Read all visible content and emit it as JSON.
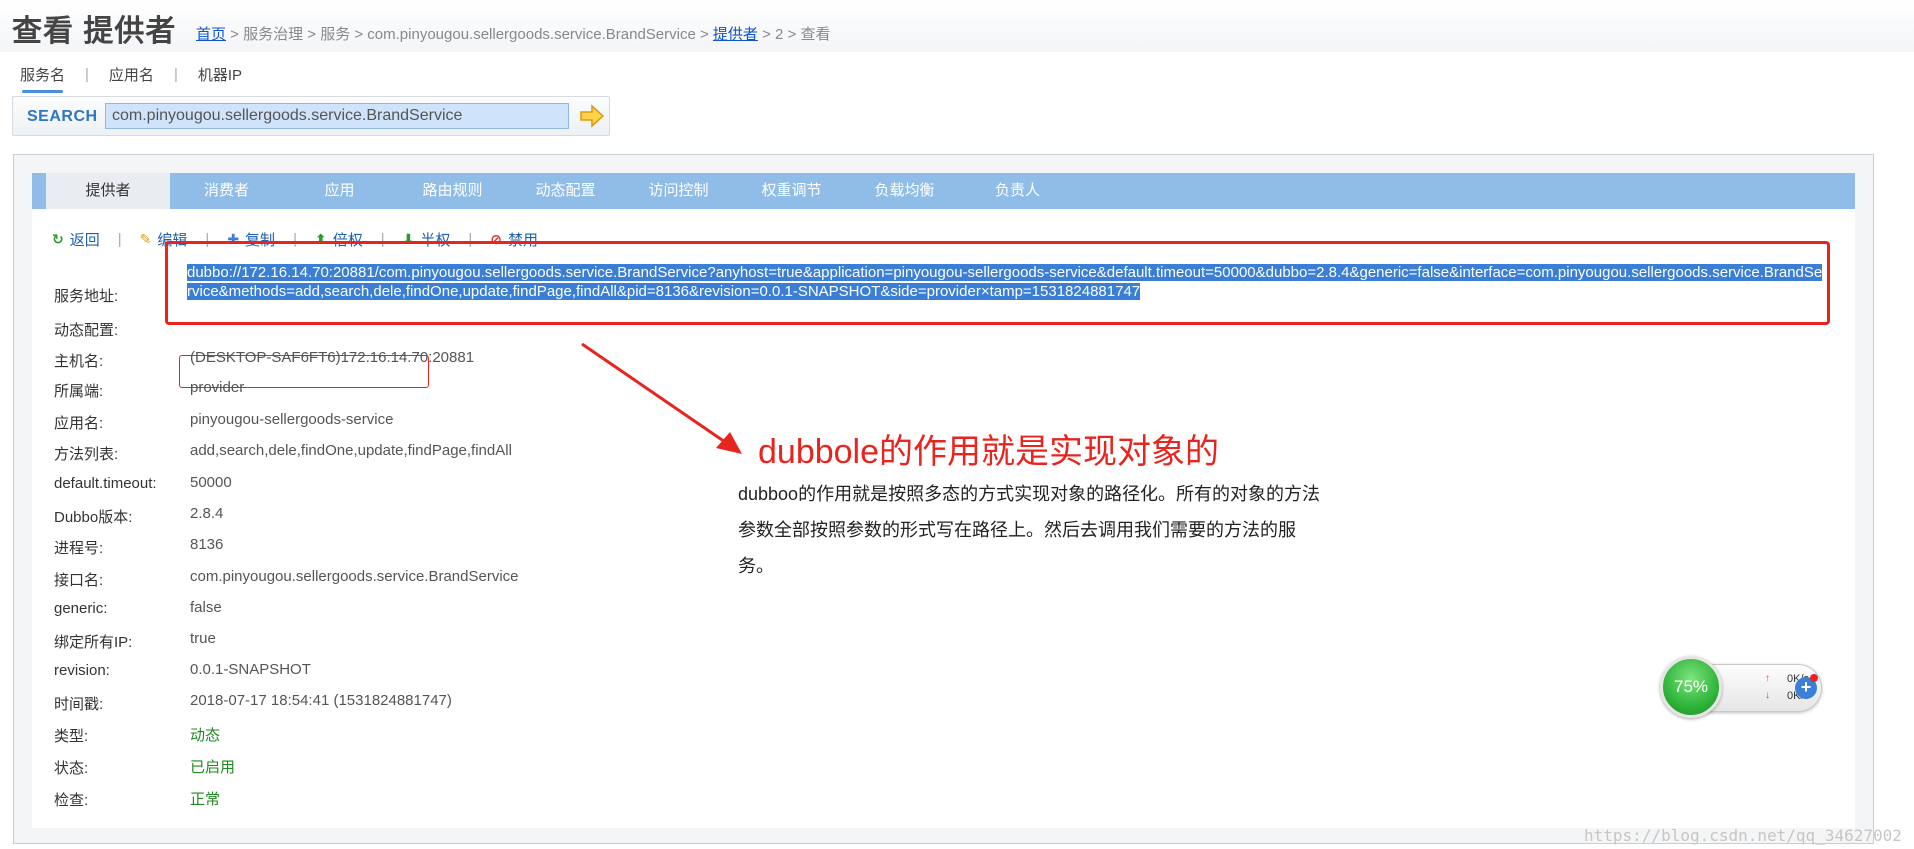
{
  "header": {
    "title": "查看 提供者",
    "breadcrumb": {
      "home": "首页",
      "mid": " > 服务治理 > 服务 > com.pinyougou.sellergoods.service.BrandService > ",
      "provider_link": "提供者",
      "tail": " > 2 > 查看"
    }
  },
  "search": {
    "tabs": [
      "服务名",
      "应用名",
      "机器IP"
    ],
    "label": "SEARCH",
    "value": "com.pinyougou.sellergoods.service.BrandService"
  },
  "tabs": [
    "提供者",
    "消费者",
    "应用",
    "路由规则",
    "动态配置",
    "访问控制",
    "权重调节",
    "负载均衡",
    "负责人"
  ],
  "actions": [
    {
      "label": "返回",
      "icon": "back-icon"
    },
    {
      "label": "编辑",
      "icon": "pencil-icon"
    },
    {
      "label": "复制",
      "icon": "plus-icon"
    },
    {
      "label": "倍权",
      "icon": "arrow-up-icon"
    },
    {
      "label": "半权",
      "icon": "arrow-down-icon"
    },
    {
      "label": "禁用",
      "icon": "ban-icon"
    }
  ],
  "details": {
    "url_label": "服务地址:",
    "url_value": "dubbo://172.16.14.70:20881/com.pinyougou.sellergoods.service.BrandService?anyhost=true&application=pinyougou-sellergoods-service&default.timeout=50000&dubbo=2.8.4&generic=false&interface=com.pinyougou.sellergoods.service.BrandService&methods=add,search,dele,findOne,update,findPage,findAll&pid=8136&revision=0.0.1-SNAPSHOT&side=provider×tamp=1531824881747",
    "dynamic_label": "动态配置:",
    "host_label": "主机名:",
    "host_value": "(DESKTOP-SAF6FT6)172.16.14.70:20881",
    "side_label": "所属端:",
    "side_value": "provider",
    "app_label": "应用名:",
    "app_value": "pinyougou-sellergoods-service",
    "methods_label": "方法列表:",
    "methods_value": "add,search,dele,findOne,update,findPage,findAll",
    "timeout_label": "default.timeout:",
    "timeout_value": "50000",
    "dubbo_label": "Dubbo版本:",
    "dubbo_value": "2.8.4",
    "pid_label": "进程号:",
    "pid_value": "8136",
    "interface_label": "接口名:",
    "interface_value": "com.pinyougou.sellergoods.service.BrandService",
    "generic_label": "generic:",
    "generic_value": "false",
    "anyhost_label": "绑定所有IP:",
    "anyhost_value": "true",
    "revision_label": "revision:",
    "revision_value": "0.0.1-SNAPSHOT",
    "time_label": "时间戳:",
    "time_value": "2018-07-17 18:54:41 (1531824881747)",
    "type_label": "类型:",
    "type_value": "动态",
    "status_label": "状态:",
    "status_value": "已启用",
    "check_label": "检查:",
    "check_value": "正常"
  },
  "annotation": {
    "title": "dubbole的作用就是实现对象的",
    "text": "dubboo的作用就是按照多态的方式实现对象的路径化。所有的对象的方法参数全部按照参数的形式写在路径上。然后去调用我们需要的方法的服务。"
  },
  "widget": {
    "percent": "75%",
    "up_speed": "0K/s",
    "down_speed": "0K/s"
  },
  "watermark": "https://blog.csdn.net/qq_34627002",
  "colors": {
    "tab_bar": "#8fbde8",
    "annotation_red": "#e8241f",
    "link_blue": "#1e5fb3",
    "status_green": "#1f8a1f"
  }
}
